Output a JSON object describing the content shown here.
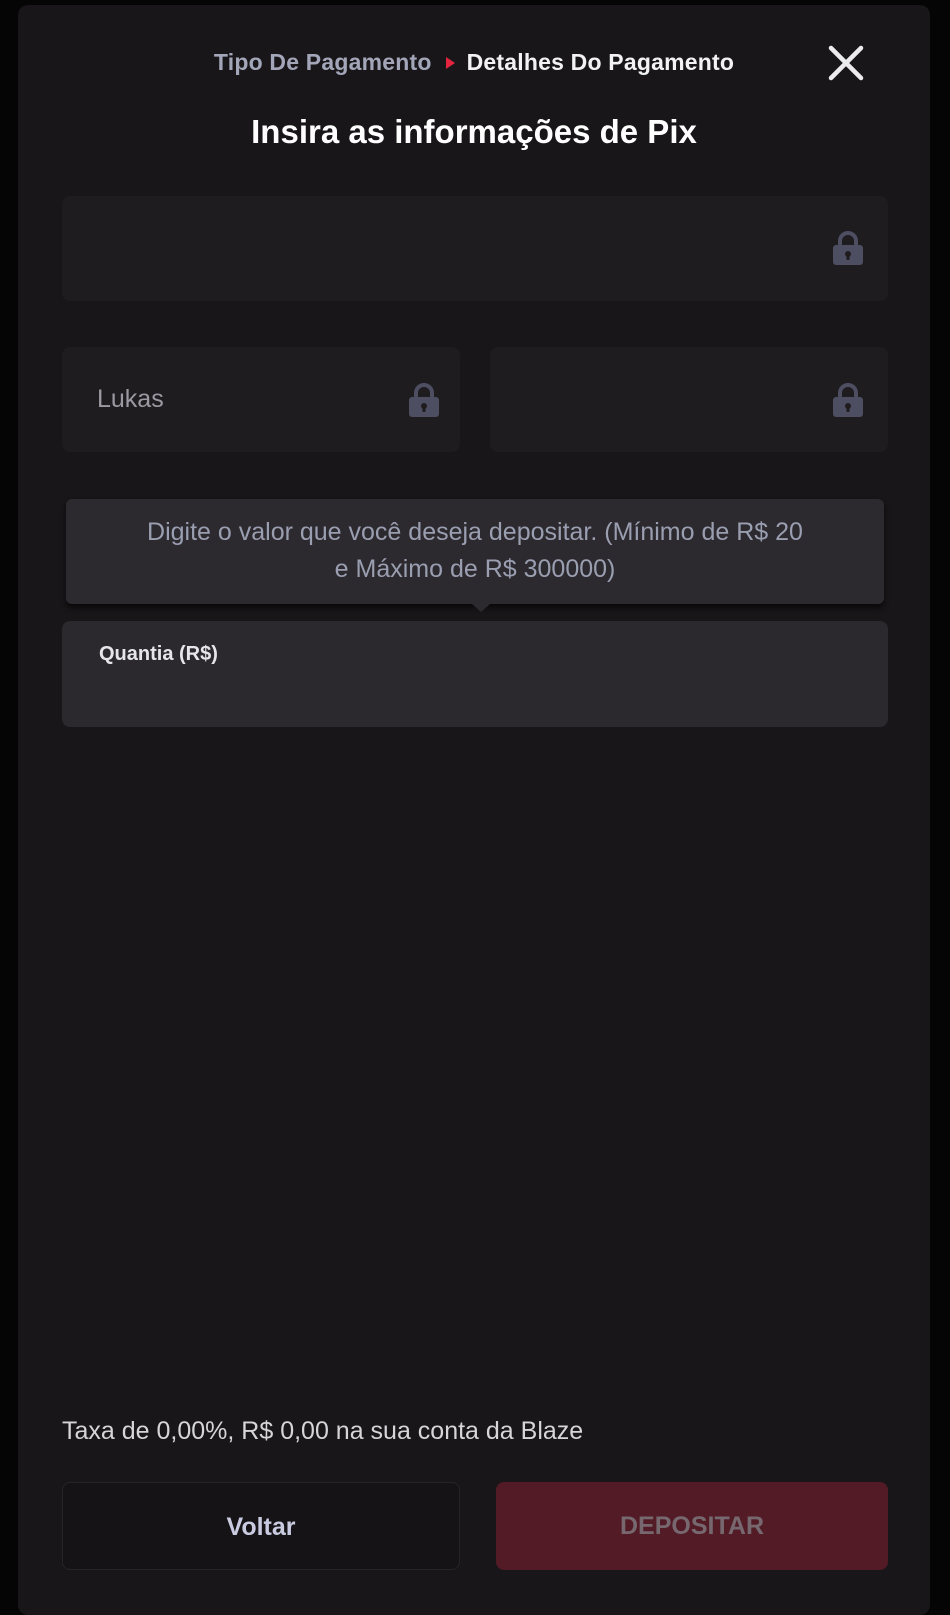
{
  "breadcrumb": {
    "previous": "Tipo De Pagamento",
    "current": "Detalhes Do Pagamento"
  },
  "title": "Insira as informações de Pix",
  "fields": {
    "top_value": "",
    "first_name_value": "Lukas",
    "last_name_value": ""
  },
  "tooltip": {
    "line1": "Digite o valor que você deseja depositar. (Mínimo de R$ 20",
    "line2": "e Máximo de R$ 300000)"
  },
  "amount": {
    "label": "Quantia (R$)",
    "value": ""
  },
  "fee_text": "Taxa de 0,00%, R$ 0,00 na sua conta da Blaze",
  "buttons": {
    "back": "Voltar",
    "deposit": "DEPOSITAR"
  },
  "colors": {
    "accent": "#e5253f",
    "deposit_disabled_bg": "#521b26",
    "modal_bg": "#181618"
  },
  "icons": {
    "close": "close-icon",
    "lock": "lock-icon",
    "separator": "triangle-right-icon"
  }
}
